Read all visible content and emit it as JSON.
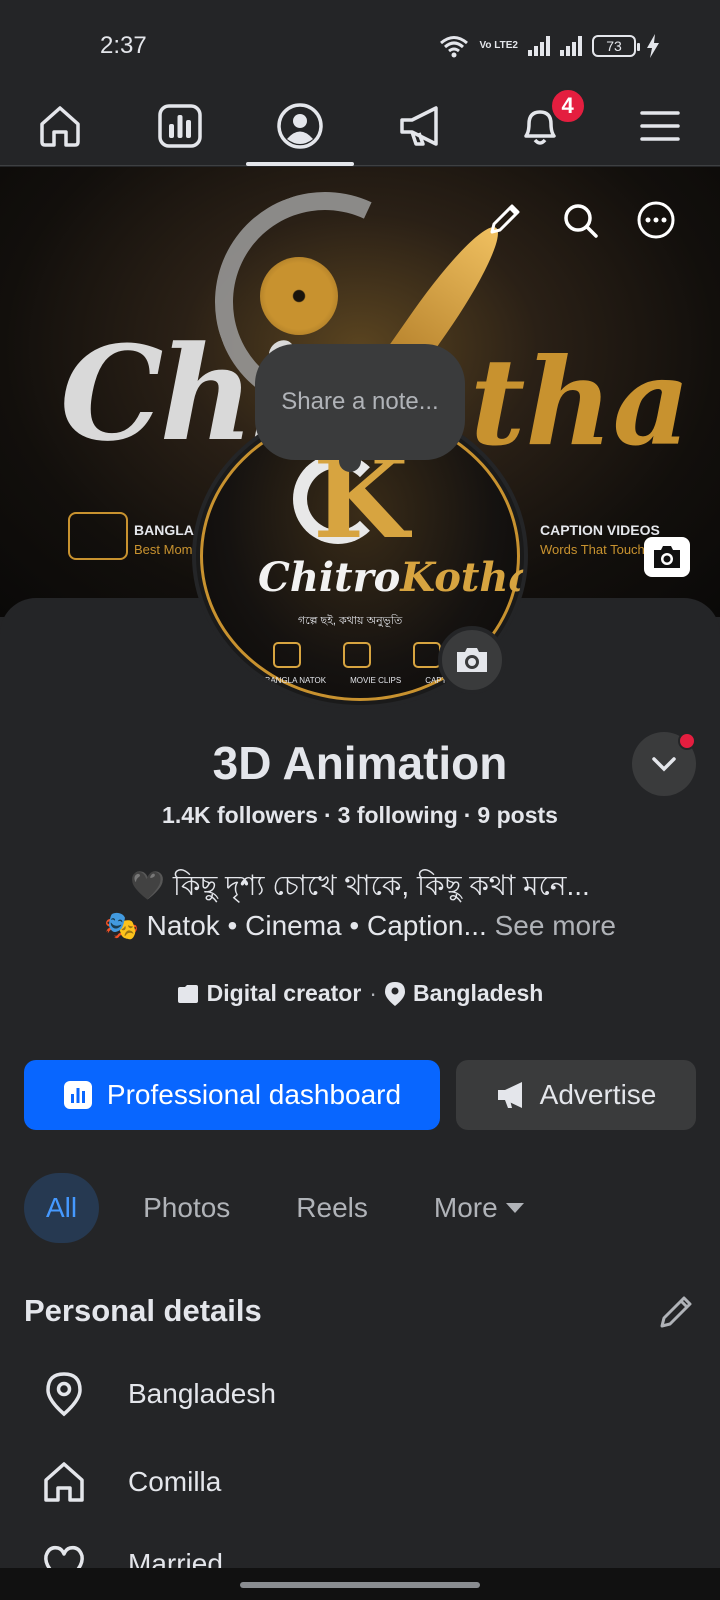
{
  "status_bar": {
    "time": "2:37",
    "battery": "73",
    "volte": "Vo LTE2"
  },
  "nav": {
    "items": [
      {
        "name": "home",
        "active": false
      },
      {
        "name": "dashboard",
        "active": false
      },
      {
        "name": "profile",
        "active": true
      },
      {
        "name": "ads",
        "active": false
      },
      {
        "name": "notifications",
        "active": false,
        "badge": "4"
      },
      {
        "name": "menu",
        "active": false
      }
    ]
  },
  "cover": {
    "big_left": "Chi",
    "big_right": "tha",
    "left_caption_title": "BANGLA",
    "left_caption_sub": "Best Mom",
    "right_caption_title": "CAPTION VIDEOS",
    "right_caption_sub": "Words That Touch"
  },
  "avatar": {
    "letter": "K",
    "title_a": "Chitro",
    "title_b": "Kotha",
    "tagline": "গল্পে ছই, কথায় অনুভূতি",
    "labels": [
      "BANGLA NATOK",
      "MOVIE CLIPS",
      "CAPTION VIDEOS"
    ]
  },
  "note": {
    "placeholder": "Share a note..."
  },
  "profile": {
    "name": "3D Animation",
    "followers": "1.4K followers",
    "following": "3 following",
    "posts": "9 posts",
    "bio_line1": "🖤 কিছু দৃশ্য চোখে থাকে, কিছু কথা মনে...",
    "bio_line2": "🎭 Natok • Cinema • Caption...",
    "see_more": "See more",
    "category": "Digital creator",
    "location": "Bangladesh"
  },
  "buttons": {
    "dashboard": "Professional dashboard",
    "advertise": "Advertise"
  },
  "tabs": [
    "All",
    "Photos",
    "Reels",
    "More"
  ],
  "personal_details": {
    "title": "Personal details",
    "items": [
      {
        "icon": "location-pin-icon",
        "label": "Bangladesh"
      },
      {
        "icon": "home-icon",
        "label": "Comilla"
      },
      {
        "icon": "heart-icon",
        "label": "Married"
      }
    ]
  },
  "colors": {
    "bg": "#242527",
    "accent": "#0866ff",
    "badge": "#e41e3f",
    "gold": "#c8922f"
  }
}
